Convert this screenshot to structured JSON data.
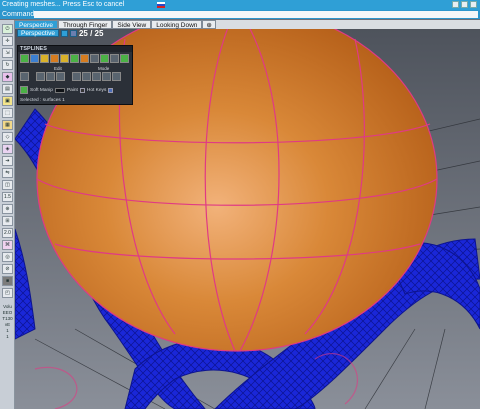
{
  "status_bar": {
    "message": "Creating meshes... Press Esc to cancel"
  },
  "command_line": {
    "label": "Command:",
    "value": ""
  },
  "viewport_tabs": [
    {
      "label": "Perspective",
      "active": true
    },
    {
      "label": "Through Finger",
      "active": false
    },
    {
      "label": "Side View",
      "active": false
    },
    {
      "label": "Looking Down",
      "active": false
    }
  ],
  "viewport": {
    "name": "Perspective",
    "counter": "25 / 25"
  },
  "left_toolbar": {
    "labels": [
      "1.5",
      "2.0",
      "Volu",
      "EEO",
      "T130",
      "vE",
      "1",
      "1"
    ]
  },
  "tsplines_panel": {
    "title": "TSPLINES",
    "section_edit": "Edit",
    "section_mode": "Mode",
    "soft_manip_label": "Soft Manip",
    "paint_label": "Paint",
    "hot_keys_label": "Hot Keys",
    "selection_label": "Selected : surfaces 1"
  },
  "colors": {
    "accent": "#2f9fd6",
    "sphere": "#d88a3c",
    "mesh": "#1d2ee0",
    "curves": "#e03a84"
  }
}
